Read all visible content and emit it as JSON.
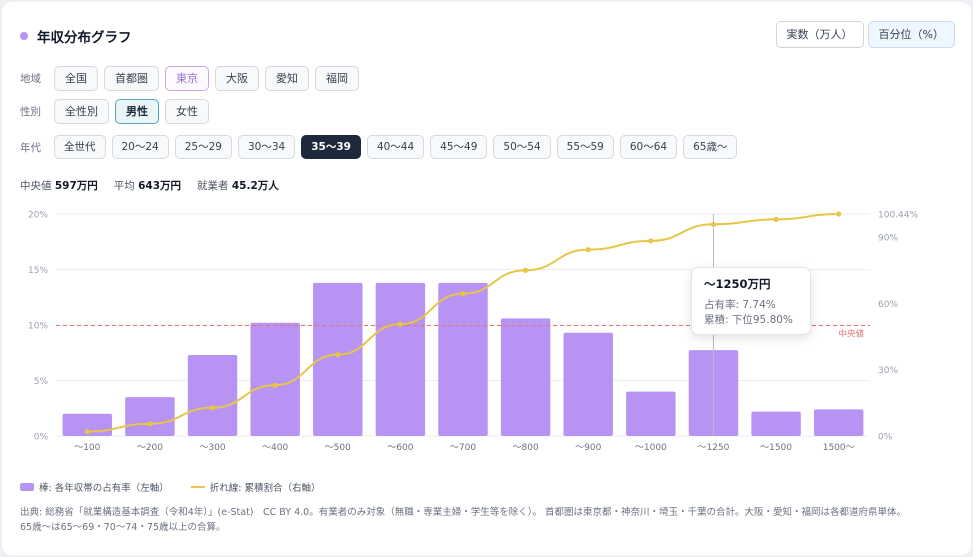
{
  "header": {
    "title": "年収分布グラフ"
  },
  "mode_toggle": [
    {
      "label": "実数（万人）",
      "active": false
    },
    {
      "label": "百分位（%）",
      "active": true
    }
  ],
  "filters": {
    "region": {
      "label": "地域",
      "options": [
        "全国",
        "首都圏",
        "東京",
        "大阪",
        "愛知",
        "福岡"
      ],
      "selected": "東京"
    },
    "gender": {
      "label": "性別",
      "options": [
        "全性別",
        "男性",
        "女性"
      ],
      "selected": "男性"
    },
    "age": {
      "label": "年代",
      "options": [
        "全世代",
        "20〜24",
        "25〜29",
        "30〜34",
        "35〜39",
        "40〜44",
        "45〜49",
        "50〜54",
        "55〜59",
        "60〜64",
        "65歳〜"
      ],
      "selected": "35〜39"
    }
  },
  "stats": {
    "median_label": "中央値",
    "median_value": "597万円",
    "mean_label": "平均",
    "mean_value": "643万円",
    "workers_label": "就業者",
    "workers_value": "45.2万人"
  },
  "colors": {
    "bar": "#b794f4",
    "line": "#e8c547",
    "median_line": "#e57373",
    "grid": "#eceef2",
    "axis_text": "#9aa1ac"
  },
  "chart_data": {
    "type": "bar",
    "categories": [
      "〜100",
      "〜200",
      "〜300",
      "〜400",
      "〜500",
      "〜600",
      "〜700",
      "〜800",
      "〜900",
      "〜1000",
      "〜1250",
      "〜1500",
      "1500〜"
    ],
    "series": [
      {
        "axis": "left",
        "type": "bar",
        "values": [
          2.0,
          3.5,
          7.3,
          10.2,
          13.8,
          13.8,
          13.8,
          10.6,
          9.3,
          4.0,
          7.74,
          2.2,
          2.4
        ]
      },
      {
        "axis": "right",
        "type": "line",
        "values": [
          2.0,
          5.5,
          12.8,
          23.0,
          36.8,
          50.6,
          64.4,
          75.0,
          84.3,
          88.3,
          95.8,
          98.0,
          100.44
        ]
      }
    ],
    "left_axis": {
      "ylim": [
        0,
        20
      ],
      "ticks": [
        "0%",
        "5%",
        "10%",
        "15%",
        "20%"
      ]
    },
    "right_axis": {
      "ylim": [
        0,
        100.44
      ],
      "ticks": [
        {
          "value": 0,
          "label": "0%"
        },
        {
          "value": 30,
          "label": "30%"
        },
        {
          "value": 60,
          "label": "60%"
        },
        {
          "value": 90,
          "label": "90%"
        },
        {
          "value": 100.44,
          "label": "100.44%"
        }
      ]
    },
    "median_line": {
      "right_value": 50,
      "label": "中央値"
    },
    "highlight_index": 10,
    "grid": true
  },
  "tooltip": {
    "title": "〜1250万円",
    "share": "占有率: 7.74%",
    "cumulative": "累積: 下位95.80%"
  },
  "legend": {
    "bar_label": "棒: 各年収帯の占有率（左軸）",
    "line_label": "折れ線: 累積割合（右軸）"
  },
  "source": {
    "line1": "出典: 総務省「就業構造基本調査（令和4年）」(e-Stat)　CC BY 4.0。有業者のみ対象（無職・専業主婦・学生等を除く）。 首都圏は東京都・神奈川・埼玉・千葉の合計。大阪・愛知・福岡は各都道府県単体。",
    "line2": "65歳〜は65〜69・70〜74・75歳以上の合算。"
  }
}
